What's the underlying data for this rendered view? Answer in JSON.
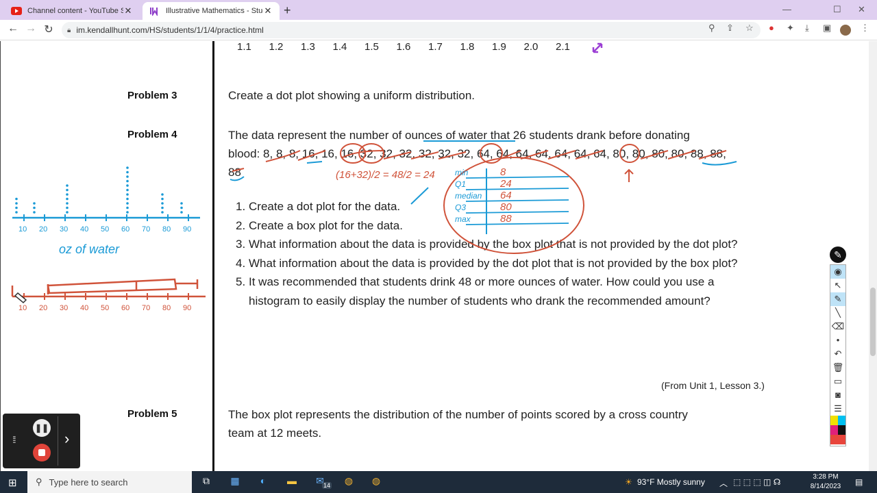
{
  "browser": {
    "tabs": [
      {
        "title": "Channel content - YouTube Studio",
        "active": false
      },
      {
        "title": "Illustrative Mathematics - Student",
        "active": true
      }
    ],
    "url": "im.kendallhunt.com/HS/students/1/1/4/practice.html"
  },
  "page": {
    "axis_numbers": [
      "1.1",
      "1.2",
      "1.3",
      "1.4",
      "1.5",
      "1.6",
      "1.7",
      "1.8",
      "1.9",
      "2.0",
      "2.1"
    ],
    "problem3": {
      "label": "Problem 3",
      "text": "Create a dot plot showing a uniform distribution."
    },
    "problem4": {
      "label": "Problem 4",
      "intro_line1": "The data represent the number of ounces of water that 26 students drank before donating",
      "intro_line2": "blood: 8, 8, 8, 16, 16, 16, 32, 32, 32, 32, 32, 32, 64, 64, 64, 64, 64, 64, 64, 80, 80, 80, 80, 88, 88,",
      "intro_line3": "88",
      "items": [
        {
          "num": "1.",
          "text": "Create a dot plot for the data."
        },
        {
          "num": "2.",
          "text": "Create a box plot for the data."
        },
        {
          "num": "3.",
          "text": "What information about the data is provided by the box plot that is not provided by the dot plot?"
        },
        {
          "num": "4.",
          "text": "What information about the data is provided by the dot plot that is not provided by the box plot?"
        },
        {
          "num": "5.",
          "text": "It was recommended that students drink 48 or more ounces of water. How could you use a histogram to easily display the number of students who drank the recommended amount?"
        }
      ],
      "source_note": "(From Unit 1, Lesson 3.)"
    },
    "problem5": {
      "label": "Problem 5",
      "text_line1": "The box plot represents the distribution of the number of points scored by a cross country",
      "text_line2": "team at 12 meets."
    }
  },
  "annotations": {
    "dotplot_caption": "oz of water",
    "dotplot_ticks": [
      "10",
      "20",
      "30",
      "40",
      "50",
      "60",
      "70",
      "80",
      "90"
    ],
    "boxplot_ticks": [
      "10",
      "20",
      "30",
      "40",
      "50",
      "60",
      "70",
      "80",
      "90"
    ],
    "calc": "(16+32)/2 = 48/2 = 24",
    "summary_table": [
      {
        "label": "min",
        "value": "8"
      },
      {
        "label": "Q1",
        "value": "24"
      },
      {
        "label": "median",
        "value": "64"
      },
      {
        "label": "Q3",
        "value": "80"
      },
      {
        "label": "max",
        "value": "88"
      }
    ],
    "ink_colors": {
      "red": "#d0533a",
      "blue": "#1a9ad6",
      "purple": "#9b3fd4"
    }
  },
  "taskbar": {
    "search_placeholder": "Type here to search",
    "mail_badge": "14",
    "weather": "93°F  Mostly sunny",
    "time": "3:28 PM",
    "date": "8/14/2023"
  }
}
